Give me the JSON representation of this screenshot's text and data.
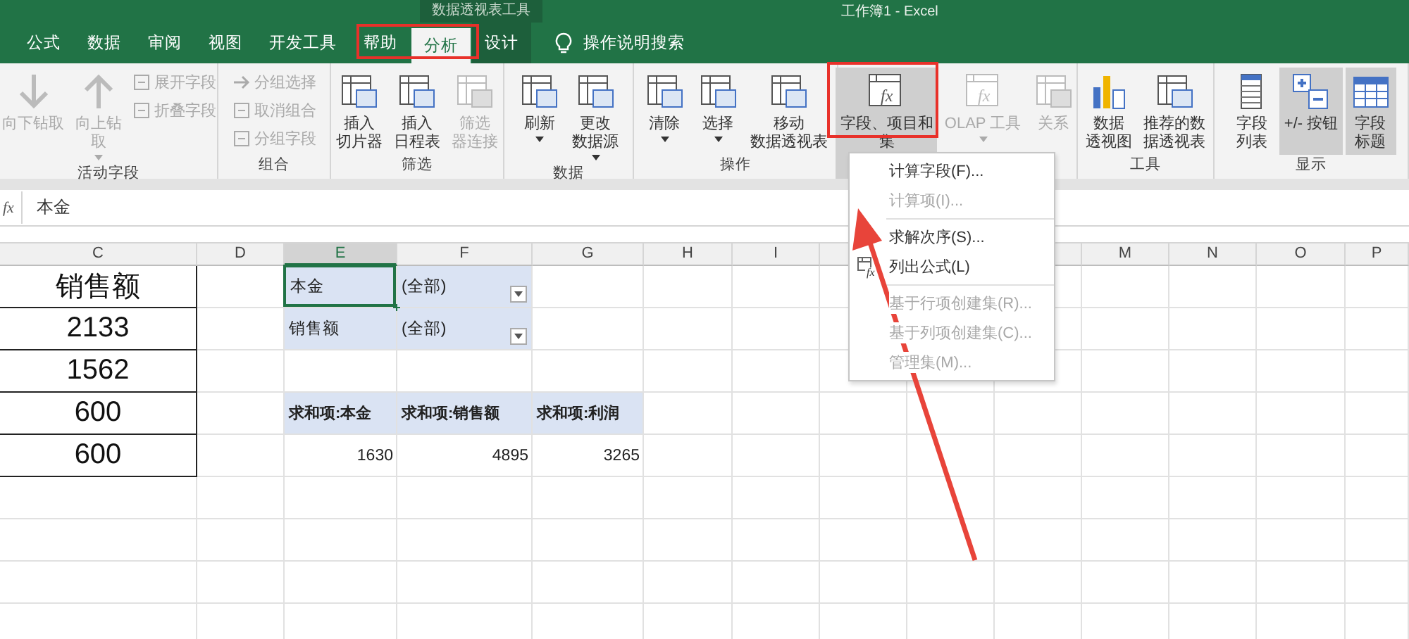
{
  "window": {
    "title": "工作簿1  -  Excel",
    "context_label": "数据透视表工具"
  },
  "tabs": [
    {
      "label": "公式",
      "selected": false,
      "contextual": false
    },
    {
      "label": "数据",
      "selected": false,
      "contextual": false
    },
    {
      "label": "审阅",
      "selected": false,
      "contextual": false
    },
    {
      "label": "视图",
      "selected": false,
      "contextual": false
    },
    {
      "label": "开发工具",
      "selected": false,
      "contextual": false
    },
    {
      "label": "帮助",
      "selected": false,
      "contextual": false
    },
    {
      "label": "分析",
      "selected": true,
      "contextual": true
    },
    {
      "label": "设计",
      "selected": false,
      "contextual": true
    }
  ],
  "tell_me": {
    "label": "操作说明搜索"
  },
  "ribbon": {
    "groups": [
      {
        "label": "活动字段",
        "buttons": [
          {
            "kind": "large",
            "lines": [
              "向下钻取"
            ],
            "dropdown": false,
            "disabled": true,
            "selected": false
          },
          {
            "kind": "large",
            "lines": [
              "向上钻",
              "取"
            ],
            "dropdown": true,
            "disabled": true,
            "selected": false
          },
          {
            "kind": "stack",
            "items": [
              {
                "label": "展开字段",
                "disabled": true
              },
              {
                "label": "折叠字段",
                "disabled": true
              }
            ]
          }
        ]
      },
      {
        "label": "组合",
        "buttons": [
          {
            "kind": "stack",
            "items": [
              {
                "label": "分组选择",
                "disabled": true
              },
              {
                "label": "取消组合",
                "disabled": true
              },
              {
                "label": "分组字段",
                "disabled": true
              }
            ]
          }
        ]
      },
      {
        "label": "筛选",
        "buttons": [
          {
            "kind": "large",
            "lines": [
              "插入",
              "切片器"
            ],
            "dropdown": false,
            "disabled": false,
            "selected": false
          },
          {
            "kind": "large",
            "lines": [
              "插入",
              "日程表"
            ],
            "dropdown": false,
            "disabled": false,
            "selected": false
          },
          {
            "kind": "large",
            "lines": [
              "筛选",
              "器连接"
            ],
            "dropdown": false,
            "disabled": true,
            "selected": false
          }
        ]
      },
      {
        "label": "数据",
        "buttons": [
          {
            "kind": "large",
            "lines": [
              "刷新"
            ],
            "dropdown": true,
            "disabled": false,
            "selected": false
          },
          {
            "kind": "large",
            "lines": [
              "更改",
              "数据源"
            ],
            "dropdown": true,
            "disabled": false,
            "selected": false
          }
        ]
      },
      {
        "label": "操作",
        "buttons": [
          {
            "kind": "large",
            "lines": [
              "清除"
            ],
            "dropdown": true,
            "disabled": false,
            "selected": false
          },
          {
            "kind": "large",
            "lines": [
              "选择"
            ],
            "dropdown": true,
            "disabled": false,
            "selected": false
          },
          {
            "kind": "large",
            "lines": [
              "移动",
              "数据透视表"
            ],
            "dropdown": false,
            "disabled": false,
            "selected": false
          }
        ]
      },
      {
        "buttons": [
          {
            "kind": "large",
            "lines": [
              "字段、项目和",
              "集"
            ],
            "glyph": "fx",
            "dropdown": true,
            "disabled": false,
            "selected": true
          },
          {
            "kind": "large",
            "lines": [
              "OLAP 工具"
            ],
            "glyph": "fx",
            "dropdown": true,
            "disabled": true,
            "selected": false
          },
          {
            "kind": "large",
            "lines": [
              "关系"
            ],
            "dropdown": false,
            "disabled": true,
            "selected": false
          }
        ]
      },
      {
        "label": "工具",
        "buttons": [
          {
            "kind": "large",
            "lines": [
              "数据",
              "透视图"
            ],
            "dropdown": false,
            "disabled": false,
            "selected": false
          },
          {
            "kind": "large",
            "lines": [
              "推荐的数",
              "据透视表"
            ],
            "dropdown": false,
            "disabled": false,
            "selected": false
          }
        ]
      },
      {
        "label": "显示",
        "buttons": [
          {
            "kind": "large",
            "lines": [
              "字段",
              "列表"
            ],
            "dropdown": false,
            "disabled": false,
            "selected": false
          },
          {
            "kind": "large",
            "lines": [
              "+/- 按钮"
            ],
            "dropdown": false,
            "disabled": false,
            "selected": true
          },
          {
            "kind": "large",
            "lines": [
              "字段",
              "标题"
            ],
            "dropdown": false,
            "disabled": false,
            "selected": true
          }
        ]
      }
    ]
  },
  "formula_bar": {
    "function_label": "fx",
    "value": "本金"
  },
  "sheet": {
    "columns": [
      {
        "label": "C",
        "selected": false
      },
      {
        "label": "D",
        "selected": false
      },
      {
        "label": "E",
        "selected": true
      },
      {
        "label": "F",
        "selected": false
      },
      {
        "label": "G",
        "selected": false
      },
      {
        "label": "H",
        "selected": false
      },
      {
        "label": "I",
        "selected": false
      },
      {
        "label": "M",
        "selected": false
      },
      {
        "label": "N",
        "selected": false
      },
      {
        "label": "O",
        "selected": false
      },
      {
        "label": "P",
        "selected": false
      }
    ],
    "source_values": [
      "销售额",
      "2133",
      "1562",
      "600",
      "600"
    ],
    "pivot": {
      "filters": [
        {
          "field": "本金",
          "value": "(全部)",
          "selected": true
        },
        {
          "field": "销售额",
          "value": "(全部)",
          "selected": false
        }
      ],
      "value_headers": [
        "求和项:本金",
        "求和项:销售额",
        "求和项:利润"
      ],
      "value_totals": [
        "1630",
        "4895",
        "3265"
      ]
    }
  },
  "menu": {
    "items": [
      {
        "kind": "item",
        "label": "计算字段(F)...",
        "disabled": false
      },
      {
        "kind": "item",
        "label": "计算项(I)...",
        "disabled": true
      },
      {
        "kind": "separator"
      },
      {
        "kind": "item",
        "label": "求解次序(S)...",
        "disabled": false
      },
      {
        "kind": "icon_item",
        "glyph": "fx",
        "label": "列出公式(L)",
        "disabled": false
      },
      {
        "kind": "separator"
      },
      {
        "kind": "item",
        "label": "基于行项创建集(R)...",
        "disabled": true
      },
      {
        "kind": "item",
        "label": "基于列项创建集(C)...",
        "disabled": true
      },
      {
        "kind": "item",
        "label": "管理集(M)...",
        "disabled": true
      }
    ]
  }
}
